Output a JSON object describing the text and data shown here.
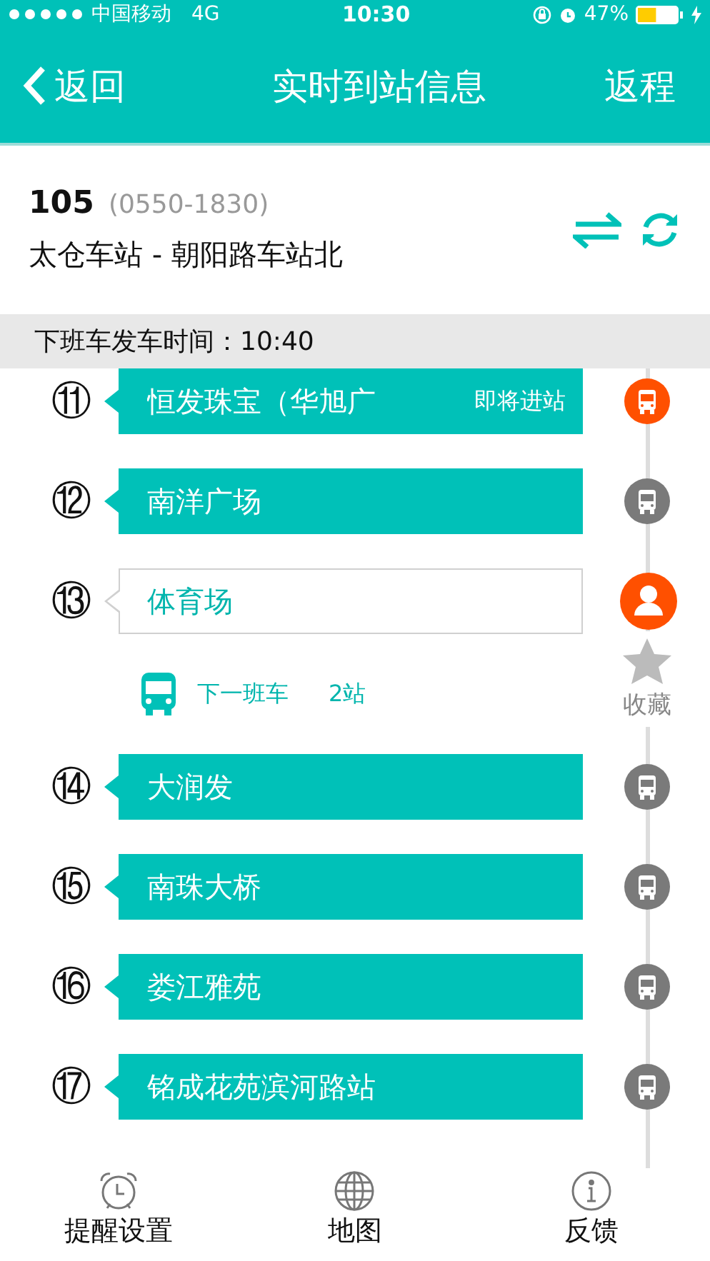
{
  "status_bar": {
    "carrier": "中国移动",
    "network": "4G",
    "time": "10:30",
    "battery": "47%"
  },
  "nav": {
    "back": "返回",
    "title": "实时到站信息",
    "action": "返程"
  },
  "route": {
    "number": "105",
    "hours": "(0550-1830)",
    "direction": "太仓车站 - 朝阳路车站北"
  },
  "notice": "下班车发车时间：10:40",
  "stations": [
    {
      "index": "⑪",
      "name": "恒发珠宝（华旭广",
      "status": "即将进站",
      "selected": false,
      "kind": "bus_arriving"
    },
    {
      "index": "⑫",
      "name": "南洋广场",
      "selected": false,
      "kind": "bus"
    },
    {
      "index": "⑬",
      "name": "体育场",
      "selected": true,
      "kind": "person",
      "next_bus": {
        "label": "下一班车",
        "stops": "2站"
      },
      "favorite": "收藏"
    },
    {
      "index": "⑭",
      "name": "大润发",
      "selected": false,
      "kind": "bus"
    },
    {
      "index": "⑮",
      "name": "南珠大桥",
      "selected": false,
      "kind": "bus"
    },
    {
      "index": "⑯",
      "name": "娄江雅苑",
      "selected": false,
      "kind": "bus"
    },
    {
      "index": "⑰",
      "name": "铭成花苑滨河路站",
      "selected": false,
      "kind": "bus"
    }
  ],
  "tabs": [
    {
      "label": "提醒设置",
      "kind": "alarm"
    },
    {
      "label": "地图",
      "kind": "globe"
    },
    {
      "label": "反馈",
      "kind": "info"
    }
  ]
}
